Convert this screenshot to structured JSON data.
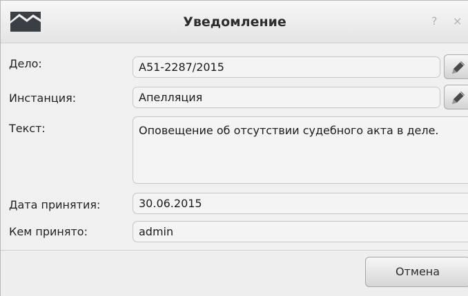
{
  "window": {
    "title": "Уведомление",
    "help_glyph": "?",
    "close_glyph": "×",
    "icon": "mountain-logo-icon"
  },
  "form": {
    "case": {
      "label": "Дело:",
      "value": "А51-2287/2015",
      "edit_icon": "pencil-icon"
    },
    "instance": {
      "label": "Инстанция:",
      "value": "Апелляция",
      "edit_icon": "pencil-icon"
    },
    "text": {
      "label": "Текст:",
      "value": "Оповещение об отсутствии судебного акта в деле."
    },
    "date": {
      "label": "Дата принятия:",
      "value": "30.06.2015"
    },
    "accepted_by": {
      "label": "Кем принято:",
      "value": "admin"
    }
  },
  "footer": {
    "cancel_label": "Отмена"
  },
  "colors": {
    "window_bg": "#f0f0f0",
    "field_bg": "#f4f4f4",
    "logo": "#3a3f45"
  }
}
